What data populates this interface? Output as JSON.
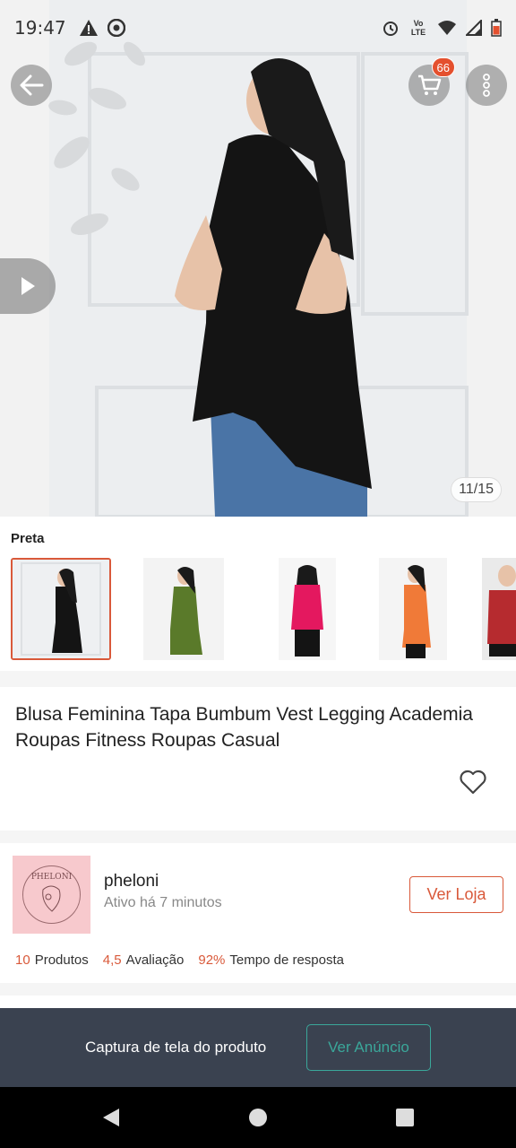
{
  "status_bar": {
    "time": "19:47",
    "left_icons": [
      "warning-icon",
      "chrome-icon"
    ],
    "right_icons": [
      "alarm-icon",
      "volte-icon",
      "wifi-icon",
      "signal-icon",
      "battery-icon"
    ],
    "volte_text": "Vo LTE"
  },
  "header": {
    "cart_count": "66"
  },
  "gallery": {
    "counter": "11/15"
  },
  "variants": {
    "label": "Preta",
    "items": [
      {
        "color": "#111111",
        "selected": true
      },
      {
        "color": "#5a7a2a",
        "selected": false
      },
      {
        "color": "#e4185f",
        "selected": false
      },
      {
        "color": "#f07a38",
        "selected": false
      },
      {
        "color": "#b62b2f",
        "selected": false
      }
    ]
  },
  "product": {
    "title": "Blusa Feminina Tapa Bumbum Vest Legging Academia Roupas Fitness Roupas Casual"
  },
  "shop": {
    "logo_text": "PHELONI",
    "name": "pheloni",
    "active": "Ativo há 7 minutos",
    "store_button": "Ver Loja",
    "products_count": "10",
    "products_label": "Produtos",
    "rating": "4,5",
    "rating_label": "Avaliação",
    "response_rate": "92%",
    "response_label": "Tempo de resposta"
  },
  "banner": {
    "text": "Captura de tela do produto",
    "button": "Ver Anúncio"
  },
  "colors": {
    "accent": "#d9593a",
    "teal": "#3aa79a",
    "banner_bg": "#3a4250"
  }
}
